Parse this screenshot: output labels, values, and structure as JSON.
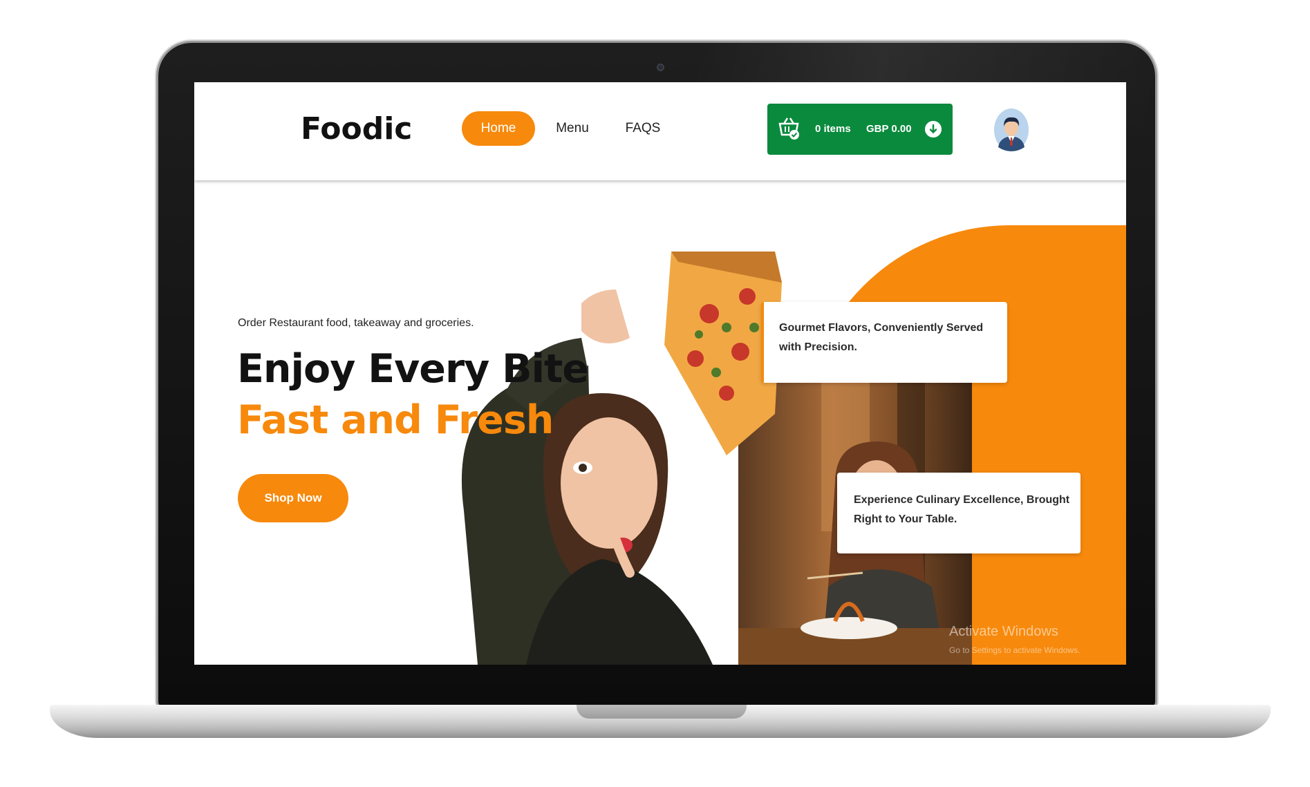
{
  "header": {
    "logo": "Foodic",
    "nav": [
      {
        "label": "Home",
        "active": true
      },
      {
        "label": "Menu",
        "active": false
      },
      {
        "label": "FAQS",
        "active": false
      }
    ],
    "cart": {
      "icon": "basket-icon",
      "items_label": "0 items",
      "total_label": "GBP 0.00",
      "toggle_icon": "arrow-down-circle-icon"
    },
    "avatar_icon": "user-avatar-icon"
  },
  "hero": {
    "tagline": "Order Restaurant food, takeaway and groceries.",
    "title": "Enjoy Every Bite",
    "title_accent": "Fast and Fresh",
    "cta_label": "Shop Now"
  },
  "cards": [
    {
      "text": "Gourmet Flavors, Conveniently Served with Precision."
    },
    {
      "text": "Experience Culinary Excellence, Brought Right to Your Table."
    }
  ],
  "watermark": {
    "title": "Activate Windows",
    "subtitle": "Go to Settings to activate Windows."
  },
  "colors": {
    "accent": "#f7890c",
    "cart_green": "#0a8a3d",
    "title_dark": "#121212"
  }
}
